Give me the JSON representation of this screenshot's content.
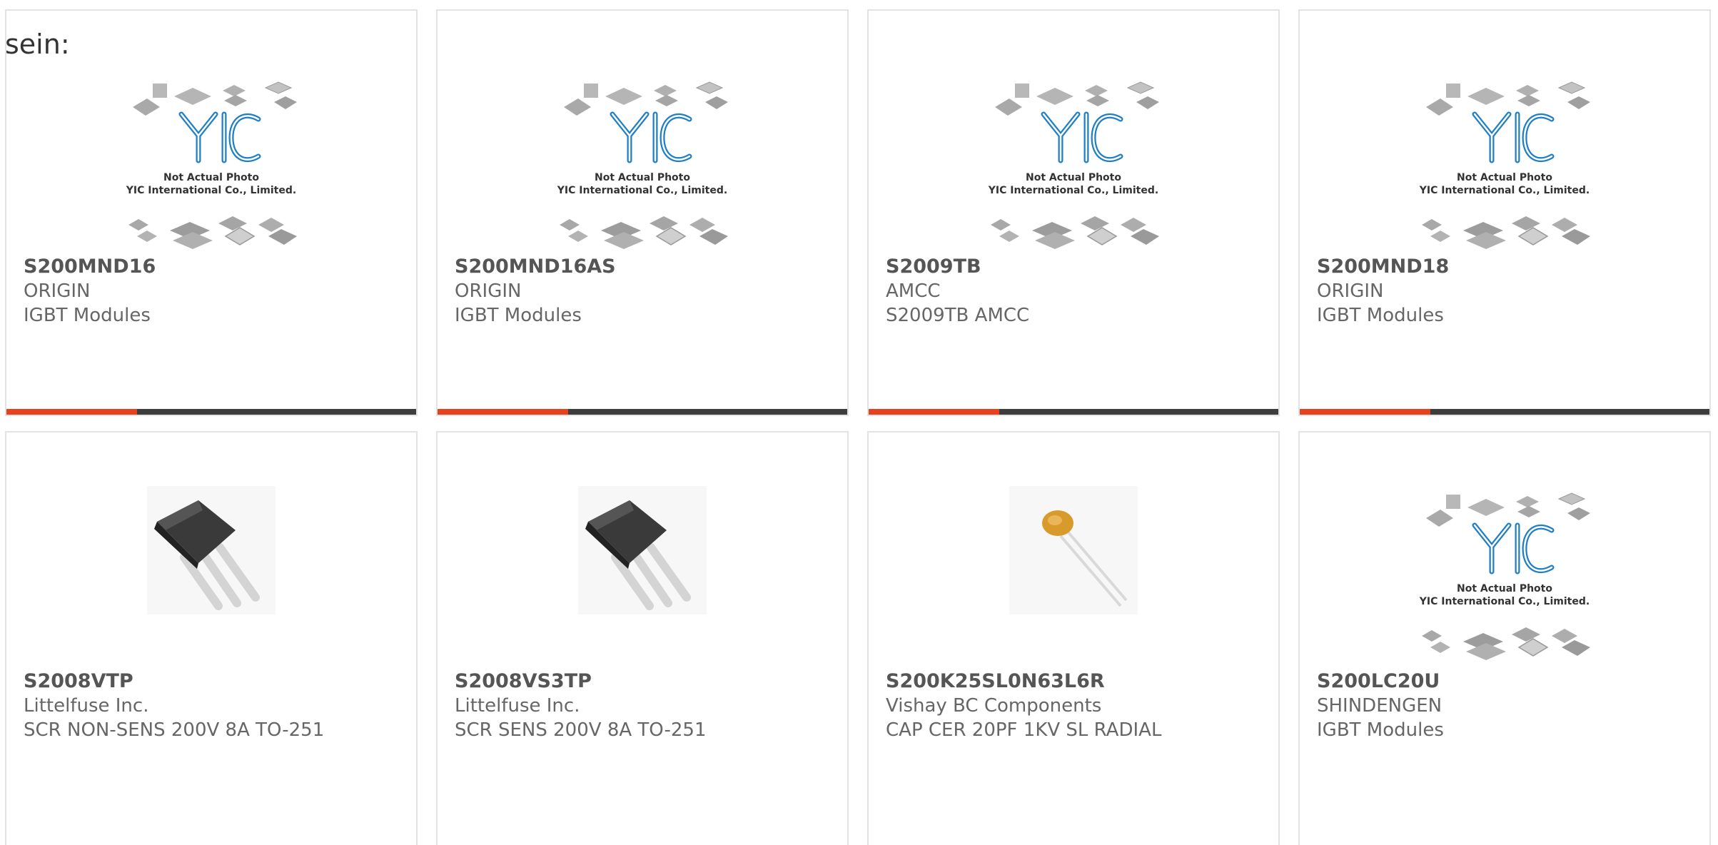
{
  "heading": "sein:",
  "placeholder": {
    "line1": "Not Actual Photo",
    "line2": "YIC International Co., Limited."
  },
  "colors": {
    "accent": "#e8411d",
    "bar": "#3d3d3d",
    "border": "#e3e3e3"
  },
  "products": [
    {
      "part": "S200MND16",
      "manufacturer": "ORIGIN",
      "description": "IGBT Modules",
      "image": "yic-placeholder"
    },
    {
      "part": "S200MND16AS",
      "manufacturer": "ORIGIN",
      "description": "IGBT Modules",
      "image": "yic-placeholder"
    },
    {
      "part": "S2009TB",
      "manufacturer": "AMCC",
      "description": "S2009TB AMCC",
      "image": "yic-placeholder"
    },
    {
      "part": "S200MND18",
      "manufacturer": "ORIGIN",
      "description": "IGBT Modules",
      "image": "yic-placeholder"
    },
    {
      "part": "S2008VTP",
      "manufacturer": "Littelfuse Inc.",
      "description": "SCR NON-SENS 200V 8A TO-251",
      "image": "to-251-package"
    },
    {
      "part": "S2008VS3TP",
      "manufacturer": "Littelfuse Inc.",
      "description": "SCR SENS 200V 8A TO-251",
      "image": "to-251-package"
    },
    {
      "part": "S200K25SL0N63L6R",
      "manufacturer": "Vishay BC Components",
      "description": "CAP CER 20PF 1KV SL RADIAL",
      "image": "ceramic-capacitor"
    },
    {
      "part": "S200LC20U",
      "manufacturer": "SHINDENGEN",
      "description": "IGBT Modules",
      "image": "yic-placeholder"
    }
  ]
}
